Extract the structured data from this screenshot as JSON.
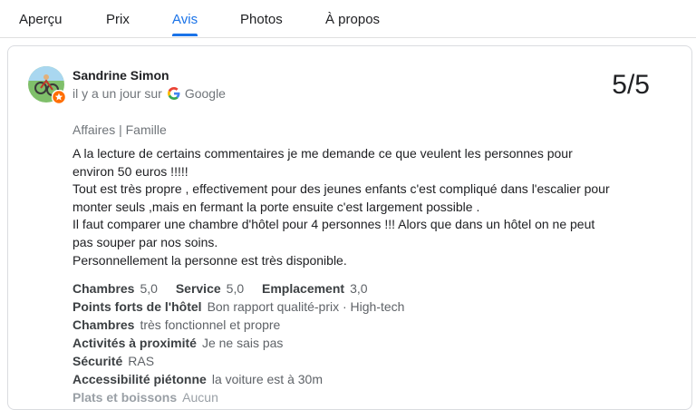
{
  "tabs": [
    {
      "label": "Aperçu",
      "active": false
    },
    {
      "label": "Prix",
      "active": false
    },
    {
      "label": "Avis",
      "active": true
    },
    {
      "label": "Photos",
      "active": false
    },
    {
      "label": "À propos",
      "active": false
    }
  ],
  "review": {
    "author": "Sandrine Simon",
    "time": "il y a un jour sur",
    "source": "Google",
    "rating": "5/5",
    "trip_type": "Affaires | Famille",
    "body_lines": [
      "A la lecture de certains commentaires je me demande ce que veulent les personnes pour",
      "environ 50 euros !!!!!",
      "Tout est très propre , effectivement pour des jeunes enfants c'est compliqué dans l'escalier pour",
      "monter seuls ,mais en fermant la porte ensuite c'est largement possible .",
      "Il faut comparer une chambre d'hôtel pour 4 personnes !!! Alors que dans un hôtel on ne peut",
      "pas souper par nos soins.",
      "Personnellement la personne est très disponible."
    ],
    "scores": [
      {
        "label": "Chambres",
        "value": "5,0"
      },
      {
        "label": "Service",
        "value": "5,0"
      },
      {
        "label": "Emplacement",
        "value": "3,0"
      }
    ],
    "details": [
      {
        "label": "Points forts de l'hôtel",
        "value": "Bon rapport qualité-prix · High-tech"
      },
      {
        "label": "Chambres",
        "value": "très fonctionnel et propre"
      },
      {
        "label": "Activités à proximité",
        "value": "Je ne sais pas"
      },
      {
        "label": "Sécurité",
        "value": "RAS"
      },
      {
        "label": "Accessibilité piétonne",
        "value": "la voiture est à 30m"
      },
      {
        "label": "Plats et boissons",
        "value": "Aucun"
      }
    ]
  },
  "colors": {
    "accent": "#1a73e8",
    "secondary_text": "#70757a",
    "border": "#dadce0"
  }
}
